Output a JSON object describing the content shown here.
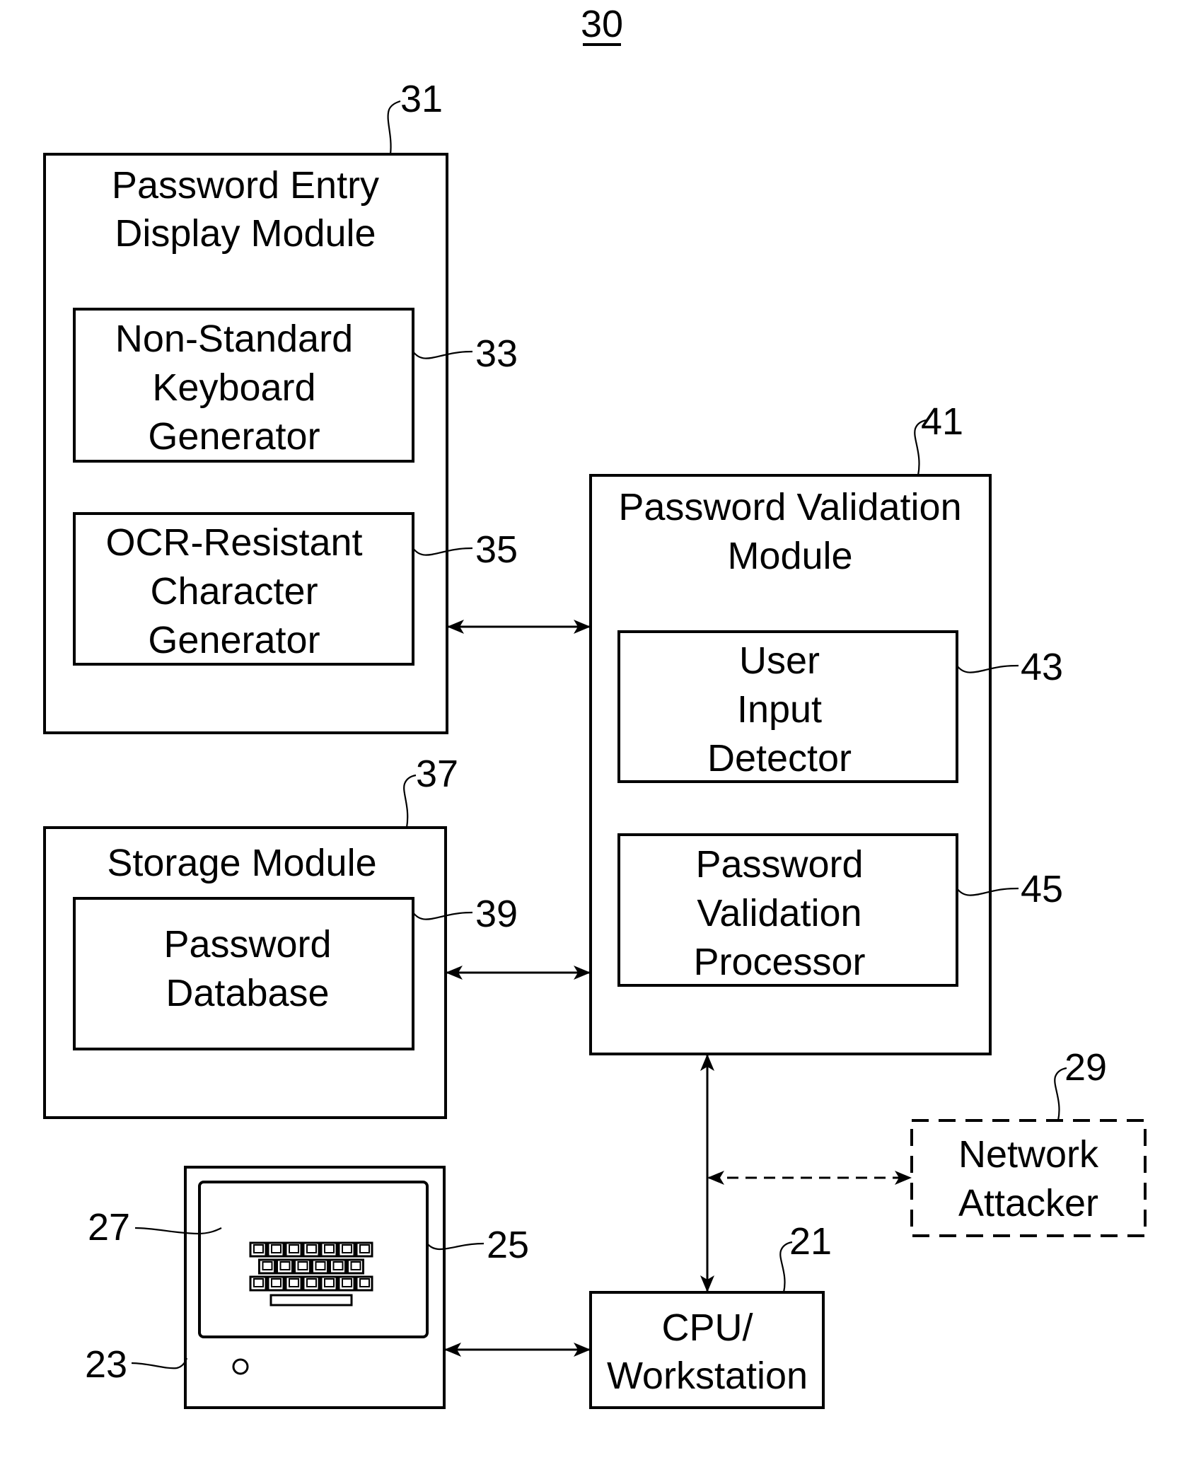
{
  "figure": {
    "number": "30",
    "blocks": {
      "password_entry_display_module": {
        "ref": "31",
        "lines": [
          "Password Entry",
          "Display Module"
        ]
      },
      "non_standard_keyboard_generator": {
        "ref": "33",
        "lines": [
          "Non-Standard",
          "Keyboard",
          "Generator"
        ]
      },
      "ocr_resistant_character_generator": {
        "ref": "35",
        "lines": [
          "OCR-Resistant",
          "Character",
          "Generator"
        ]
      },
      "storage_module": {
        "ref": "37",
        "lines": [
          "Storage Module"
        ]
      },
      "password_database": {
        "ref": "39",
        "lines": [
          "Password",
          "Database"
        ]
      },
      "password_validation_module": {
        "ref": "41",
        "lines": [
          "Password Validation",
          "Module"
        ]
      },
      "user_input_detector": {
        "ref": "43",
        "lines": [
          "User",
          "Input",
          "Detector"
        ]
      },
      "password_validation_processor": {
        "ref": "45",
        "lines": [
          "Password",
          "Validation",
          "Processor"
        ]
      },
      "network_attacker": {
        "ref": "29",
        "lines": [
          "Network",
          "Attacker"
        ],
        "style": "dashed"
      },
      "cpu_workstation": {
        "ref": "21",
        "lines": [
          "CPU/",
          "Workstation"
        ]
      },
      "terminal": {
        "ref": "23"
      },
      "display_screen": {
        "ref": "25"
      },
      "on_screen_keyboard": {
        "ref": "27",
        "rows": [
          7,
          6,
          7
        ],
        "has_space_bar": true
      }
    },
    "connections": [
      {
        "from": "31",
        "to": "41",
        "type": "bidirectional"
      },
      {
        "from": "37",
        "to": "41",
        "type": "bidirectional"
      },
      {
        "from": "41",
        "to": "21",
        "type": "bidirectional"
      },
      {
        "from": "23",
        "to": "21",
        "type": "bidirectional"
      },
      {
        "from": "41-21 link",
        "to": "29",
        "type": "bidirectional-dashed"
      }
    ]
  }
}
